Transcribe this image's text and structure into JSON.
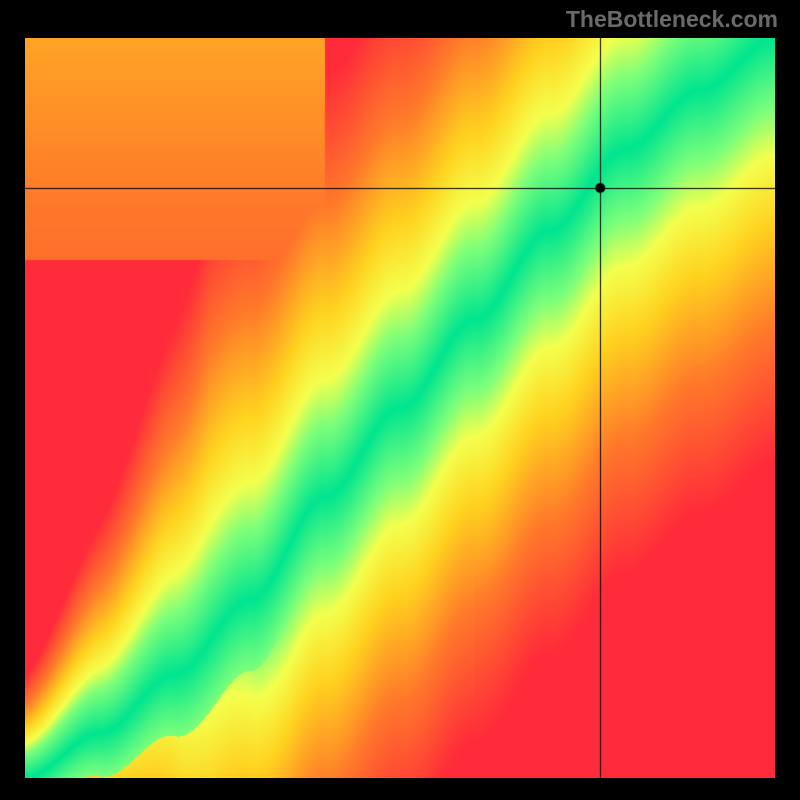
{
  "attribution": "TheBottleneck.com",
  "chart_data": {
    "type": "heatmap",
    "title": "",
    "xlabel": "",
    "ylabel": "",
    "xlim": [
      0,
      100
    ],
    "ylim": [
      0,
      100
    ],
    "crosshair": {
      "x": 76.8,
      "y": 79.7
    },
    "marker": {
      "x": 76.8,
      "y": 79.7
    },
    "ridge": {
      "description": "Green optimal band along a curved diagonal; red far from it; yellow transitional.",
      "control_points": [
        {
          "x": 0,
          "y": 0
        },
        {
          "x": 10,
          "y": 6
        },
        {
          "x": 20,
          "y": 14
        },
        {
          "x": 30,
          "y": 24
        },
        {
          "x": 40,
          "y": 38
        },
        {
          "x": 50,
          "y": 50
        },
        {
          "x": 60,
          "y": 62
        },
        {
          "x": 70,
          "y": 74
        },
        {
          "x": 80,
          "y": 85
        },
        {
          "x": 90,
          "y": 93
        },
        {
          "x": 100,
          "y": 100
        }
      ],
      "band_halfwidth_pct": 4.0
    },
    "colorscale": [
      {
        "t": 0.0,
        "color": "#ff2b3a"
      },
      {
        "t": 0.35,
        "color": "#ff7a2a"
      },
      {
        "t": 0.62,
        "color": "#ffd21f"
      },
      {
        "t": 0.8,
        "color": "#f4ff4d"
      },
      {
        "t": 0.92,
        "color": "#7dff7a"
      },
      {
        "t": 1.0,
        "color": "#00e58f"
      }
    ]
  }
}
